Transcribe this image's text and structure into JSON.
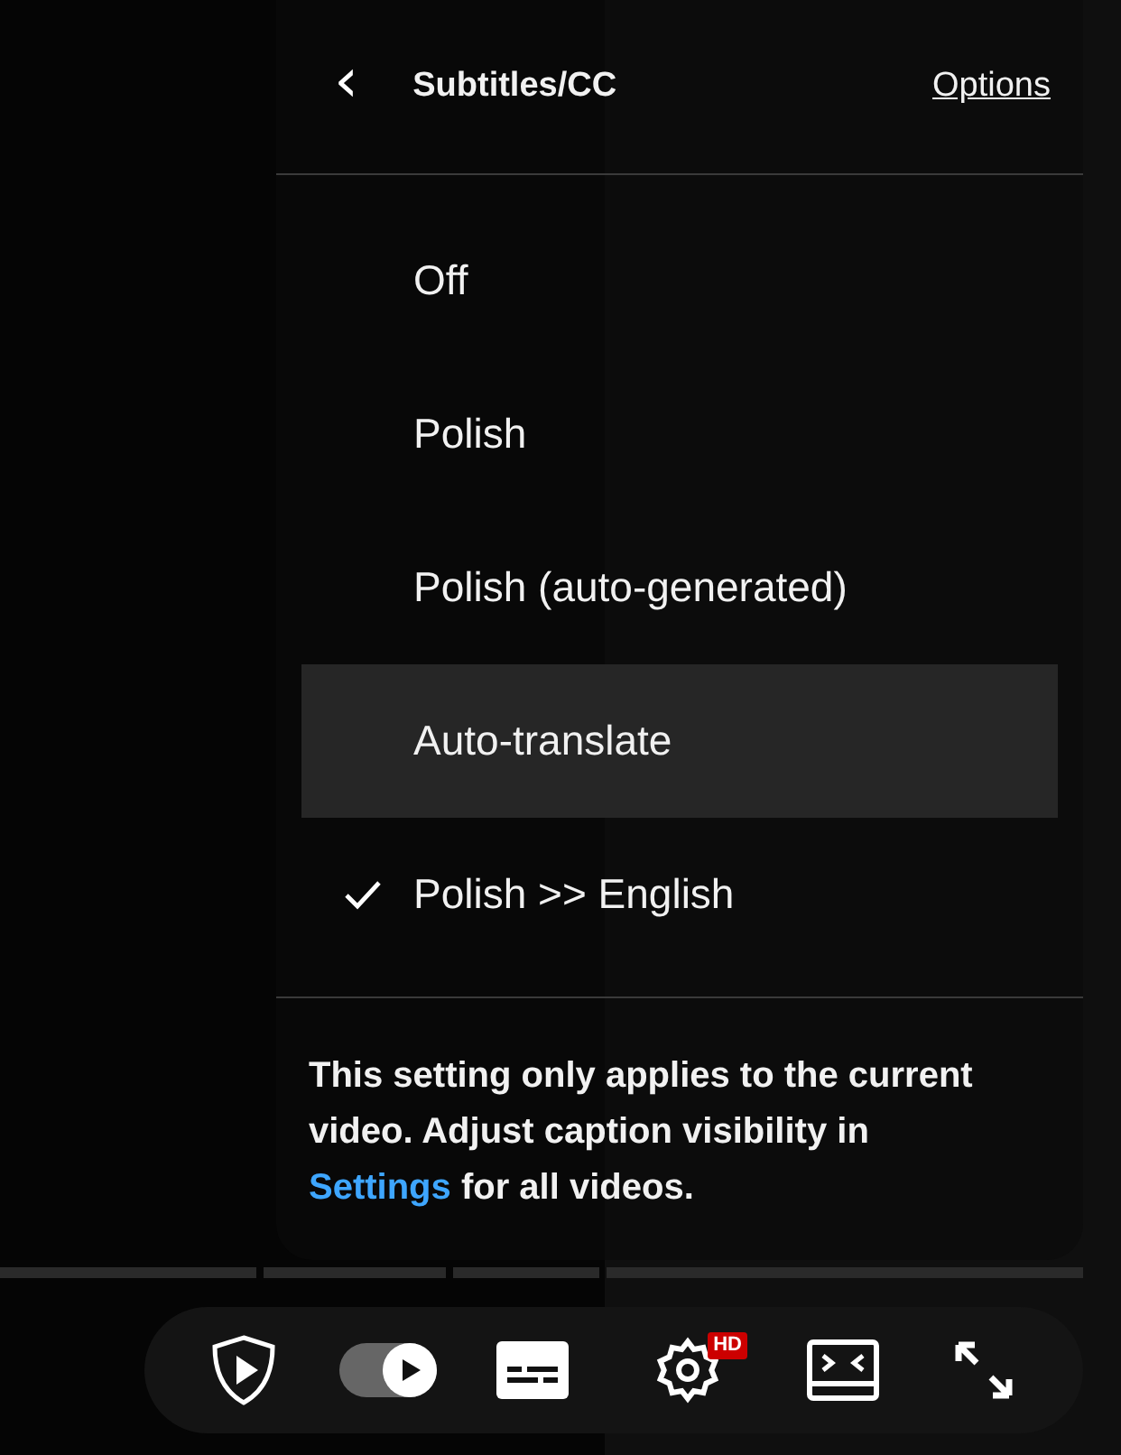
{
  "header": {
    "back": "‹",
    "title": "Subtitles/CC",
    "options": "Options"
  },
  "items": [
    {
      "label": "Off",
      "selected": false,
      "highlighted": false
    },
    {
      "label": "Polish",
      "selected": false,
      "highlighted": false
    },
    {
      "label": "Polish (auto-generated)",
      "selected": false,
      "highlighted": false
    },
    {
      "label": "Auto-translate",
      "selected": false,
      "highlighted": true
    },
    {
      "label": "Polish >> English",
      "selected": true,
      "highlighted": false
    }
  ],
  "note": {
    "before": "This setting only applies to the current video. Adjust caption visibility in ",
    "link": "Settings",
    "after": " for all videos."
  },
  "controls": {
    "autoplay": {
      "on": true
    },
    "quality_badge": "HD"
  }
}
